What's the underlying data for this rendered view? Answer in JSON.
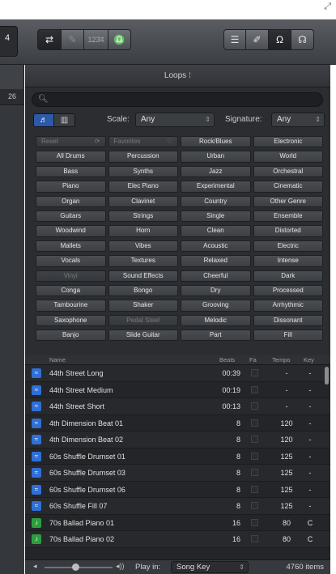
{
  "toolbar": {
    "left_edge_label": "4",
    "loop_glyph": "⇄",
    "pencil_glyph": "✎",
    "count_in_label": "123̄4",
    "metronome_glyph": "♎",
    "list_glyph": "☰",
    "note_glyph": "✐",
    "loop_browser_glyph": "Ω",
    "media_glyph": "☊",
    "resize_glyph": "⤢"
  },
  "track_strip": {
    "ruler_number": "26"
  },
  "loops": {
    "title": "Loops ⁝",
    "search_glyph": "🔍︎",
    "view_toggle": {
      "button_glyph": "♬",
      "column_glyph": "▥"
    },
    "scale": {
      "label": "Scale:",
      "value": "Any"
    },
    "signature": {
      "label": "Signature:",
      "value": "Any"
    },
    "select_arrows": "⇕"
  },
  "keywords": [
    {
      "label": "Reset",
      "disabled": true,
      "suffix": "⟳"
    },
    {
      "label": "Favorites",
      "disabled": true,
      "suffix": "♡"
    },
    {
      "label": "Rock/Blues"
    },
    {
      "label": "Electronic"
    },
    {
      "label": "All Drums"
    },
    {
      "label": "Percussion"
    },
    {
      "label": "Urban"
    },
    {
      "label": "World"
    },
    {
      "label": "Bass"
    },
    {
      "label": "Synths"
    },
    {
      "label": "Jazz"
    },
    {
      "label": "Orchestral"
    },
    {
      "label": "Piano"
    },
    {
      "label": "Elec Piano"
    },
    {
      "label": "Experimental"
    },
    {
      "label": "Cinematic"
    },
    {
      "label": "Organ"
    },
    {
      "label": "Clavinet"
    },
    {
      "label": "Country"
    },
    {
      "label": "Other Genre"
    },
    {
      "label": "Guitars"
    },
    {
      "label": "Strings"
    },
    {
      "label": "Single"
    },
    {
      "label": "Ensemble"
    },
    {
      "label": "Woodwind"
    },
    {
      "label": "Horn"
    },
    {
      "label": "Clean"
    },
    {
      "label": "Distorted"
    },
    {
      "label": "Mallets"
    },
    {
      "label": "Vibes"
    },
    {
      "label": "Acoustic"
    },
    {
      "label": "Electric"
    },
    {
      "label": "Vocals"
    },
    {
      "label": "Textures"
    },
    {
      "label": "Relaxed"
    },
    {
      "label": "Intense"
    },
    {
      "label": "Vinyl",
      "disabled": true
    },
    {
      "label": "Sound Effects"
    },
    {
      "label": "Cheerful"
    },
    {
      "label": "Dark"
    },
    {
      "label": "Conga"
    },
    {
      "label": "Bongo"
    },
    {
      "label": "Dry"
    },
    {
      "label": "Processed"
    },
    {
      "label": "Tambourine"
    },
    {
      "label": "Shaker"
    },
    {
      "label": "Grooving"
    },
    {
      "label": "Arrhythmic"
    },
    {
      "label": "Saxophone"
    },
    {
      "label": "Pedal Steel",
      "disabled": true
    },
    {
      "label": "Melodic"
    },
    {
      "label": "Dissonant"
    },
    {
      "label": "Banjo"
    },
    {
      "label": "Slide Guitar"
    },
    {
      "label": "Part"
    },
    {
      "label": "Fill"
    }
  ],
  "table": {
    "columns": {
      "name": "Name",
      "beats": "Beats",
      "fav": "Fa",
      "tempo": "Tempo",
      "key": "Key"
    },
    "rows": [
      {
        "type": "audio",
        "icon": "≈",
        "name": "44th Street Long",
        "beats": "00:39",
        "tempo": "-",
        "key": "-"
      },
      {
        "type": "audio",
        "icon": "≈",
        "name": "44th Street Medium",
        "beats": "00:19",
        "tempo": "-",
        "key": "-"
      },
      {
        "type": "audio",
        "icon": "≈",
        "name": "44th Street Short",
        "beats": "00:13",
        "tempo": "-",
        "key": "-"
      },
      {
        "type": "audio",
        "icon": "≈",
        "name": "4th Dimension Beat 01",
        "beats": "8",
        "tempo": "120",
        "key": "-"
      },
      {
        "type": "audio",
        "icon": "≈",
        "name": "4th Dimension Beat 02",
        "beats": "8",
        "tempo": "120",
        "key": "-"
      },
      {
        "type": "audio",
        "icon": "≈",
        "name": "60s Shuffle Drumset 01",
        "beats": "8",
        "tempo": "125",
        "key": "-"
      },
      {
        "type": "audio",
        "icon": "≈",
        "name": "60s Shuffle Drumset 03",
        "beats": "8",
        "tempo": "125",
        "key": "-"
      },
      {
        "type": "audio",
        "icon": "≈",
        "name": "60s Shuffle Drumset 06",
        "beats": "8",
        "tempo": "125",
        "key": "-"
      },
      {
        "type": "audio",
        "icon": "≈",
        "name": "60s Shuffle Fill 07",
        "beats": "8",
        "tempo": "125",
        "key": "-"
      },
      {
        "type": "midi",
        "icon": "♪",
        "name": "70s Ballad Piano 01",
        "beats": "16",
        "tempo": "80",
        "key": "C"
      },
      {
        "type": "midi",
        "icon": "♪",
        "name": "70s Ballad Piano 02",
        "beats": "16",
        "tempo": "80",
        "key": "C"
      }
    ]
  },
  "footer": {
    "vol_low_glyph": "◂",
    "vol_high_glyph": "◂))",
    "play_in_label": "Play in:",
    "play_in_value": "Song Key",
    "item_count": "4760 items"
  }
}
